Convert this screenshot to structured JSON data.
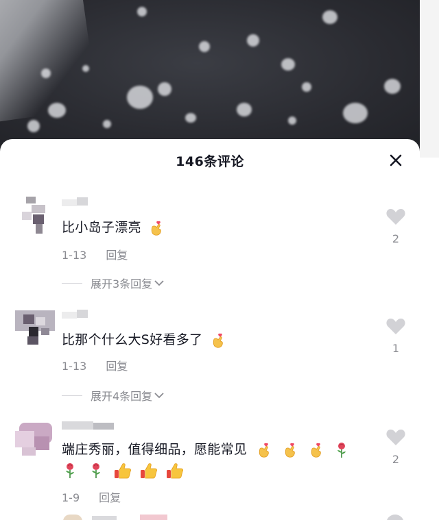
{
  "sheet": {
    "title": "146条评论",
    "close_icon": "close-icon"
  },
  "comments": [
    {
      "text": "比小岛子漂亮",
      "emojis": [
        "finger-heart-icon"
      ],
      "date": "1-13",
      "reply_label": "回复",
      "expand_label": "展开3条回复",
      "likes": "2"
    },
    {
      "text": "比那个什么大S好看多了",
      "emojis": [
        "finger-heart-icon"
      ],
      "date": "1-13",
      "reply_label": "回复",
      "expand_label": "展开4条回复",
      "likes": "1"
    },
    {
      "text": "端庄秀丽，值得细品，愿能常见",
      "emojis_line1": [
        "finger-heart-icon",
        "finger-heart-icon",
        "finger-heart-icon",
        "rose-icon"
      ],
      "emojis_line2": [
        "rose-icon",
        "rose-icon",
        "thumbs-up-icon",
        "thumbs-up-icon",
        "thumbs-up-icon"
      ],
      "date": "1-9",
      "reply_label": "回复",
      "likes": "2"
    }
  ],
  "colors": {
    "text": "#161823",
    "secondary": "#8a8b91",
    "heart": "#d2d2d6"
  }
}
